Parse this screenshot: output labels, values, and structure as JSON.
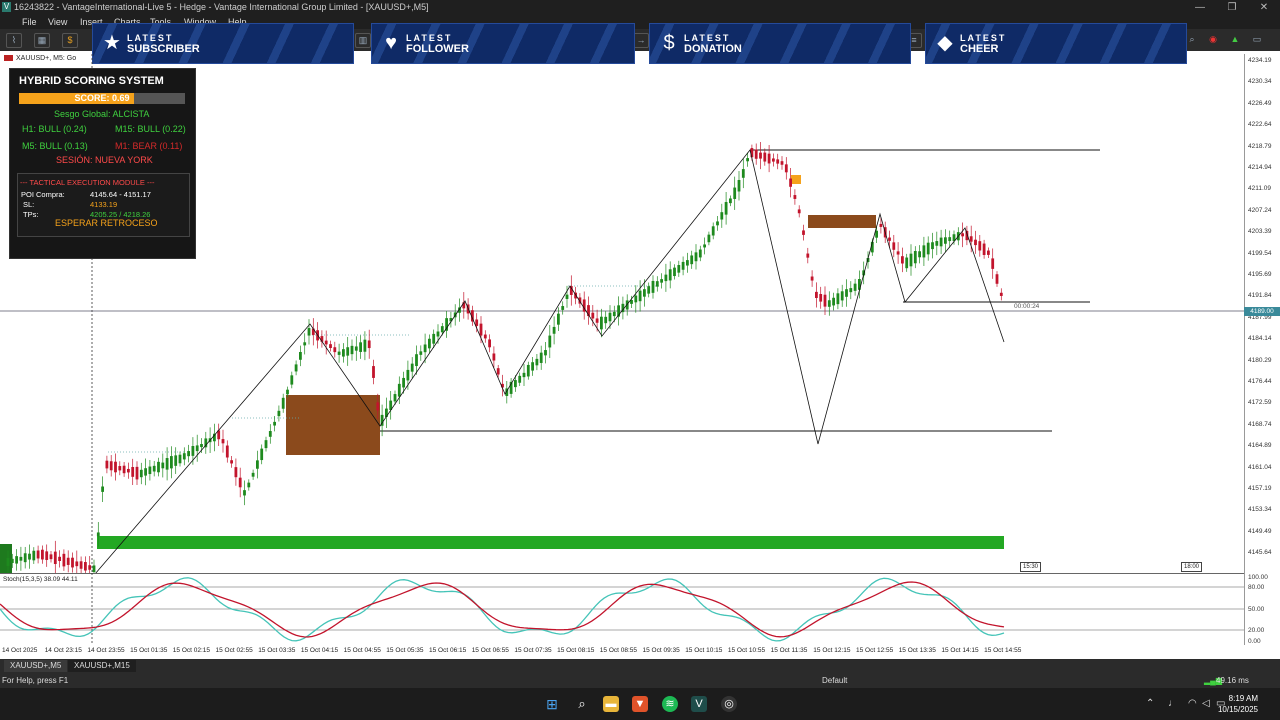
{
  "window": {
    "title": "16243822 - VantageInternational-Live 5 - Hedge - Vantage International Group Limited - [XAUUSD+,M5]",
    "icon_letter": "V",
    "controls": [
      "—",
      "❐",
      "✕"
    ]
  },
  "menu": [
    "File",
    "View",
    "Insert",
    "Charts",
    "Tools",
    "Window",
    "Help"
  ],
  "banners": [
    {
      "line1": "LATEST",
      "line2": "SUBSCRIBER",
      "icon": "star-icon"
    },
    {
      "line1": "LATEST",
      "line2": "FOLLOWER",
      "icon": "heart-icon"
    },
    {
      "line1": "LATEST",
      "line2": "DONATION",
      "icon": "dollar-icon"
    },
    {
      "line1": "LATEST",
      "line2": "CHEER",
      "icon": "diamond-icon"
    }
  ],
  "chart_header": "XAUUSD+, M5:  Go",
  "scoring_panel": {
    "title": "HYBRID SCORING SYSTEM",
    "score_label": "SCORE: 0.69",
    "score_fraction": 0.69,
    "bias": "Sesgo Global: ALCISTA",
    "h1": "H1: BULL (0.24)",
    "m15": "M15: BULL (0.22)",
    "m5": "M5: BULL (0.13)",
    "m1": "M1: BEAR (0.11)",
    "session": "SESIÓN: NUEVA YORK",
    "tactical": {
      "title": "--- TACTICAL EXECUTION MODULE ---",
      "poi_label": "POI Compra:",
      "poi_value": "4145.64 - 4151.17",
      "sl_label": "SL:",
      "sl_value": "4133.19",
      "tp_label": "TPs:",
      "tp_value": "4205.25 / 4218.26",
      "action": "ESPERAR RETROCESO"
    },
    "colors": {
      "bull": "#3fd13f",
      "bear": "#d42a2a",
      "orange": "#f5a21b",
      "bias": "#3fd13f",
      "session": "#ff4a4a"
    }
  },
  "price_scale": [
    "4234.19",
    "4230.34",
    "4226.49",
    "4222.64",
    "4218.79",
    "4214.94",
    "4211.09",
    "4207.24",
    "4203.39",
    "4199.54",
    "4195.69",
    "4191.84",
    "4187.99",
    "4184.14",
    "4180.29",
    "4176.44",
    "4172.59",
    "4168.74",
    "4164.89",
    "4161.04",
    "4157.19",
    "4153.34",
    "4149.49",
    "4145.64"
  ],
  "current_price": "4189.00",
  "countdown": "00:00:24",
  "stoch_label": "Stoch(15,3,5) 38.09 44.11",
  "stoch_scale": [
    "100.00",
    "80.00",
    "50.00",
    "20.00",
    "0.00"
  ],
  "time_axis": [
    "14 Oct 2025",
    "14 Oct 23:15",
    "14 Oct 23:55",
    "15 Oct 01:35",
    "15 Oct 02:15",
    "15 Oct 02:55",
    "15 Oct 03:35",
    "15 Oct 04:15",
    "15 Oct 04:55",
    "15 Oct 05:35",
    "15 Oct 06:15",
    "15 Oct 06:55",
    "15 Oct 07:35",
    "15 Oct 08:15",
    "15 Oct 08:55",
    "15 Oct 09:35",
    "15 Oct 10:15",
    "15 Oct 10:55",
    "15 Oct 11:35",
    "15 Oct 12:15",
    "15 Oct 12:55",
    "15 Oct 13:35",
    "15 Oct 14:15",
    "15 Oct 14:55"
  ],
  "session_markers": [
    "15:30",
    "18:00"
  ],
  "tabs": [
    "XAUUSD+,M5",
    "XAUUSD+,M15"
  ],
  "status": {
    "help": "For Help, press F1",
    "profile": "Default",
    "ping": "49.16 ms"
  },
  "clock": {
    "time": "8:19 AM",
    "date": "10/15/2025"
  }
}
